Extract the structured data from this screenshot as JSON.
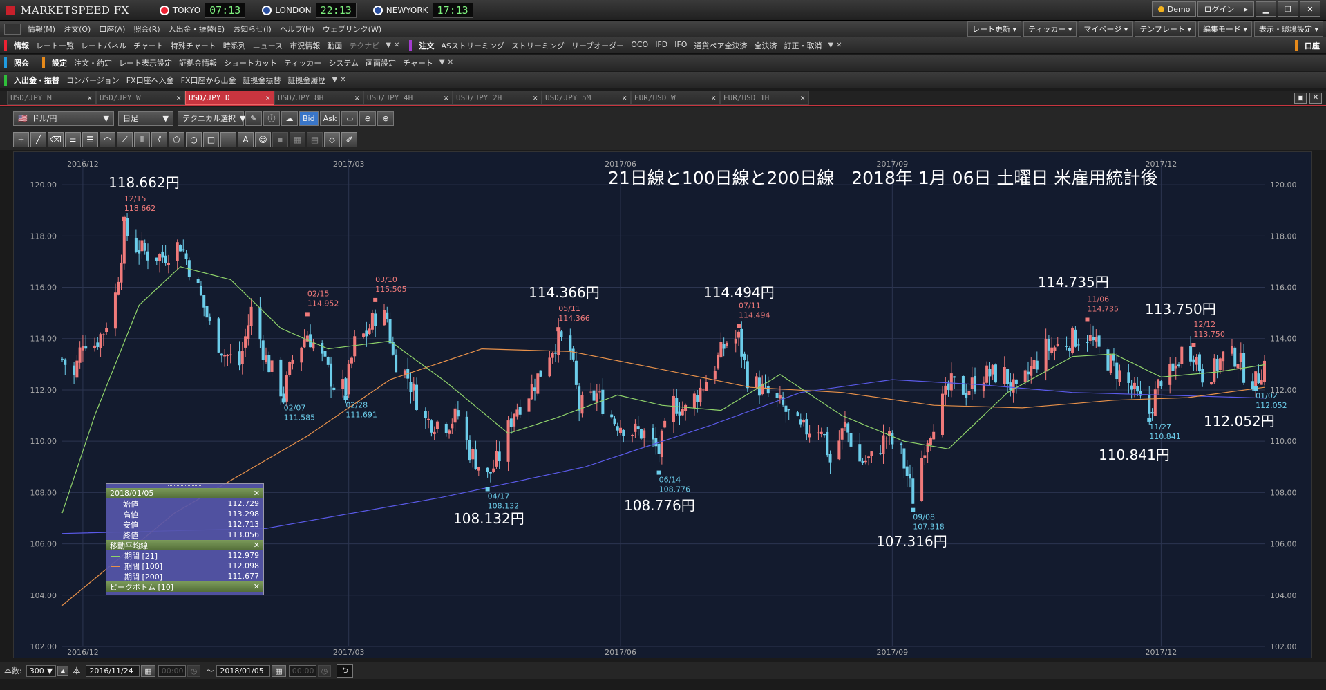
{
  "app": {
    "logo": "MARKETSPEED FX"
  },
  "clocks": [
    {
      "city": "TOKYO",
      "time": "07:13",
      "color": "#e23"
    },
    {
      "city": "LONDON",
      "time": "22:13",
      "color": "#2a4fa0"
    },
    {
      "city": "NEWYORK",
      "time": "17:13",
      "color": "#2a4fa0"
    }
  ],
  "window": {
    "demo": "Demo",
    "login": "ログイン"
  },
  "menu": [
    "情報(M)",
    "注文(O)",
    "口座(A)",
    "照会(R)",
    "入出金・振替(E)",
    "お知らせ(I)",
    "ヘルプ(H)",
    "ウェブリンク(W)"
  ],
  "menu_right": [
    "レート更新",
    "ティッカー",
    "マイページ",
    "テンプレート",
    "編集モード",
    "表示・環境設定"
  ],
  "toolbar1": {
    "info_head": "情報",
    "info_items": [
      "レート一覧",
      "レートパネル",
      "チャート",
      "特殊チャート",
      "時系列",
      "ニュース",
      "市況情報",
      "動画"
    ],
    "info_dim": "テクナビ",
    "order_head": "注文",
    "order_items": [
      "ASストリーミング",
      "ストリーミング",
      "リーブオーダー",
      "OCO",
      "IFD",
      "IFO",
      "通貨ペア全決済",
      "全決済",
      "訂正・取消"
    ],
    "right": "口座"
  },
  "toolbar2": {
    "inq_head": "照会",
    "set_head": "設定",
    "set_items": [
      "注文・約定",
      "レート表示設定",
      "証拠金情報",
      "ショートカット",
      "ティッカー",
      "システム",
      "画面設定",
      "チャート"
    ]
  },
  "toolbar3": {
    "head": "入出金・振替",
    "items": [
      "コンバージョン",
      "FX口座へ入金",
      "FX口座から出金",
      "証拠金振替",
      "証拠金履歴"
    ]
  },
  "tabs": [
    "USD/JPY M",
    "USD/JPY W",
    "USD/JPY D",
    "USD/JPY 8H",
    "USD/JPY 4H",
    "USD/JPY 2H",
    "USD/JPY 5M",
    "EUR/USD W",
    "EUR/USD 1H"
  ],
  "active_tab": 2,
  "chart_controls": {
    "pair": "ドル/円",
    "period": "日足",
    "tech": "テクニカル選択",
    "bid": "Bid",
    "ask": "Ask"
  },
  "overlay_title": "21日線と100日線と200日線　2018年 1月 06日 土曜日 米雇用統計後",
  "big_labels": [
    {
      "text": "118.662円"
    },
    {
      "text": "114.366円"
    },
    {
      "text": "114.494円"
    },
    {
      "text": "114.735円"
    },
    {
      "text": "113.750円"
    },
    {
      "text": "112.052円"
    },
    {
      "text": "110.841円"
    },
    {
      "text": "108.132円"
    },
    {
      "text": "108.776円"
    },
    {
      "text": "107.316円"
    }
  ],
  "info_box": {
    "date": "2018/01/05",
    "ohlc": [
      {
        "label": "始値",
        "value": "112.729"
      },
      {
        "label": "高値",
        "value": "113.298"
      },
      {
        "label": "安値",
        "value": "112.713"
      },
      {
        "label": "終値",
        "value": "113.056"
      }
    ],
    "ma_title": "移動平均線",
    "ma": [
      {
        "label": "期間 [21]",
        "value": "112.979",
        "color": "#8fd36a"
      },
      {
        "label": "期間 [100]",
        "value": "112.098",
        "color": "#e8914a"
      },
      {
        "label": "期間 [200]",
        "value": "111.677",
        "color": "#5a5ae8"
      }
    ],
    "peak_title": "ピークボトム [10]"
  },
  "status": {
    "count_label": "本数:",
    "count": "300",
    "unit": "本",
    "from_date": "2016/11/24",
    "from_time": "00:00",
    "tilde": "〜",
    "to_date": "2018/01/05",
    "to_time": "00:00"
  },
  "colors": {
    "up": "#f07a7a",
    "down": "#6ccdea",
    "ma21": "#8fd36a",
    "ma100": "#e8914a",
    "ma200": "#5a5ae8",
    "bg": "#131b2e",
    "accent": "#c8353f"
  },
  "chart_data": {
    "type": "candlestick",
    "title": "21日線と100日線と200日線　2018年 1月 06日 土曜日 米雇用統計後",
    "ylim": [
      102,
      121
    ],
    "y_ticks": [
      "102.00",
      "104.00",
      "106.00",
      "108.00",
      "110.00",
      "112.00",
      "114.00",
      "116.00",
      "118.00",
      "120.00"
    ],
    "x_ticks": [
      "2016/12",
      "2017/03",
      "2017/06",
      "2017/09",
      "2017/12"
    ],
    "x_tick_dates": [
      "2016-12-01",
      "2017-03-01",
      "2017-06-01",
      "2017-09-01",
      "2017-12-01"
    ],
    "start_date": "2016-11-24",
    "end_date": "2018-01-05",
    "close_path": [
      [
        "2016-11-24",
        113.2
      ],
      [
        "2016-11-28",
        112.5
      ],
      [
        "2016-12-01",
        114.0
      ],
      [
        "2016-12-05",
        113.8
      ],
      [
        "2016-12-08",
        114.3
      ],
      [
        "2016-12-12",
        115.7
      ],
      [
        "2016-12-15",
        118.2
      ],
      [
        "2016-12-19",
        117.6
      ],
      [
        "2016-12-23",
        117.3
      ],
      [
        "2016-12-28",
        117.2
      ],
      [
        "2017-01-03",
        117.7
      ],
      [
        "2017-01-06",
        116.8
      ],
      [
        "2017-01-10",
        115.6
      ],
      [
        "2017-01-13",
        114.5
      ],
      [
        "2017-01-18",
        113.4
      ],
      [
        "2017-01-23",
        113.0
      ],
      [
        "2017-01-27",
        115.1
      ],
      [
        "2017-02-01",
        113.2
      ],
      [
        "2017-02-07",
        111.8
      ],
      [
        "2017-02-10",
        113.2
      ],
      [
        "2017-02-15",
        114.2
      ],
      [
        "2017-02-20",
        113.2
      ],
      [
        "2017-02-24",
        112.2
      ],
      [
        "2017-02-28",
        112.0
      ],
      [
        "2017-03-03",
        113.8
      ],
      [
        "2017-03-07",
        114.2
      ],
      [
        "2017-03-10",
        114.9
      ],
      [
        "2017-03-14",
        114.8
      ],
      [
        "2017-03-16",
        113.3
      ],
      [
        "2017-03-21",
        112.5
      ],
      [
        "2017-03-27",
        110.8
      ],
      [
        "2017-04-03",
        110.7
      ],
      [
        "2017-04-07",
        111.0
      ],
      [
        "2017-04-11",
        109.6
      ],
      [
        "2017-04-17",
        108.6
      ],
      [
        "2017-04-21",
        109.4
      ],
      [
        "2017-04-26",
        111.2
      ],
      [
        "2017-05-01",
        111.9
      ],
      [
        "2017-05-05",
        112.7
      ],
      [
        "2017-05-08",
        113.5
      ],
      [
        "2017-05-11",
        114.0
      ],
      [
        "2017-05-15",
        113.5
      ],
      [
        "2017-05-18",
        111.3
      ],
      [
        "2017-05-24",
        111.8
      ],
      [
        "2017-05-30",
        110.8
      ],
      [
        "2017-06-05",
        110.4
      ],
      [
        "2017-06-09",
        110.3
      ],
      [
        "2017-06-14",
        109.6
      ],
      [
        "2017-06-19",
        111.5
      ],
      [
        "2017-06-23",
        111.2
      ],
      [
        "2017-06-29",
        112.2
      ],
      [
        "2017-07-03",
        113.0
      ],
      [
        "2017-07-07",
        113.9
      ],
      [
        "2017-07-11",
        114.0
      ],
      [
        "2017-07-14",
        112.5
      ],
      [
        "2017-07-20",
        111.9
      ],
      [
        "2017-07-26",
        111.3
      ],
      [
        "2017-08-01",
        110.4
      ],
      [
        "2017-08-08",
        110.6
      ],
      [
        "2017-08-11",
        109.2
      ],
      [
        "2017-08-16",
        110.6
      ],
      [
        "2017-08-21",
        109.2
      ],
      [
        "2017-08-25",
        109.3
      ],
      [
        "2017-08-30",
        110.2
      ],
      [
        "2017-09-04",
        109.5
      ],
      [
        "2017-09-08",
        107.8
      ],
      [
        "2017-09-12",
        109.9
      ],
      [
        "2017-09-15",
        110.8
      ],
      [
        "2017-09-21",
        112.2
      ],
      [
        "2017-09-26",
        112.0
      ],
      [
        "2017-10-02",
        112.6
      ],
      [
        "2017-10-09",
        112.6
      ],
      [
        "2017-10-13",
        111.8
      ],
      [
        "2017-10-18",
        112.8
      ],
      [
        "2017-10-23",
        113.6
      ],
      [
        "2017-10-27",
        113.7
      ],
      [
        "2017-11-01",
        114.0
      ],
      [
        "2017-11-06",
        114.1
      ],
      [
        "2017-11-10",
        113.5
      ],
      [
        "2017-11-15",
        112.9
      ],
      [
        "2017-11-20",
        112.2
      ],
      [
        "2017-11-24",
        111.5
      ],
      [
        "2017-11-27",
        111.1
      ],
      [
        "2017-12-01",
        112.5
      ],
      [
        "2017-12-05",
        112.6
      ],
      [
        "2017-12-08",
        113.5
      ],
      [
        "2017-12-12",
        113.5
      ],
      [
        "2017-12-15",
        112.6
      ],
      [
        "2017-12-19",
        112.8
      ],
      [
        "2017-12-22",
        113.3
      ],
      [
        "2017-12-27",
        113.3
      ],
      [
        "2017-12-29",
        112.7
      ],
      [
        "2018-01-02",
        112.3
      ],
      [
        "2018-01-05",
        113.06
      ]
    ],
    "ma21": [
      [
        "2016-11-24",
        107.2
      ],
      [
        "2016-12-05",
        111.0
      ],
      [
        "2016-12-20",
        115.3
      ],
      [
        "2017-01-03",
        116.8
      ],
      [
        "2017-01-20",
        116.3
      ],
      [
        "2017-02-06",
        114.4
      ],
      [
        "2017-02-22",
        113.6
      ],
      [
        "2017-03-15",
        113.9
      ],
      [
        "2017-04-03",
        112.3
      ],
      [
        "2017-04-24",
        110.3
      ],
      [
        "2017-05-10",
        110.9
      ],
      [
        "2017-05-31",
        111.8
      ],
      [
        "2017-06-15",
        111.4
      ],
      [
        "2017-07-05",
        111.2
      ],
      [
        "2017-07-25",
        112.6
      ],
      [
        "2017-08-15",
        111.0
      ],
      [
        "2017-09-05",
        110.0
      ],
      [
        "2017-09-20",
        109.7
      ],
      [
        "2017-10-10",
        111.9
      ],
      [
        "2017-11-01",
        113.3
      ],
      [
        "2017-11-15",
        113.4
      ],
      [
        "2017-12-01",
        112.5
      ],
      [
        "2017-12-20",
        112.7
      ],
      [
        "2018-01-05",
        112.98
      ]
    ],
    "ma100": [
      [
        "2016-11-24",
        103.6
      ],
      [
        "2017-01-01",
        107.2
      ],
      [
        "2017-02-15",
        110.2
      ],
      [
        "2017-03-15",
        112.4
      ],
      [
        "2017-04-15",
        113.6
      ],
      [
        "2017-05-15",
        113.5
      ],
      [
        "2017-06-15",
        112.8
      ],
      [
        "2017-07-15",
        112.1
      ],
      [
        "2017-08-15",
        111.9
      ],
      [
        "2017-09-15",
        111.4
      ],
      [
        "2017-10-15",
        111.3
      ],
      [
        "2017-11-15",
        111.6
      ],
      [
        "2017-12-10",
        111.7
      ],
      [
        "2018-01-05",
        112.1
      ]
    ],
    "ma200": [
      [
        "2016-11-24",
        106.4
      ],
      [
        "2017-02-01",
        106.6
      ],
      [
        "2017-04-01",
        107.8
      ],
      [
        "2017-05-20",
        109.0
      ],
      [
        "2017-07-01",
        110.6
      ],
      [
        "2017-08-01",
        111.9
      ],
      [
        "2017-09-01",
        112.4
      ],
      [
        "2017-10-01",
        112.2
      ],
      [
        "2017-11-01",
        111.9
      ],
      [
        "2017-12-01",
        111.8
      ],
      [
        "2018-01-05",
        111.68
      ]
    ],
    "peaks": [
      {
        "date": "12/15",
        "value": "118.662",
        "type": "high"
      },
      {
        "date": "02/15",
        "value": "114.952",
        "type": "high"
      },
      {
        "date": "03/10",
        "value": "115.505",
        "type": "high"
      },
      {
        "date": "05/11",
        "value": "114.366",
        "type": "high"
      },
      {
        "date": "07/11",
        "value": "114.494",
        "type": "high"
      },
      {
        "date": "11/06",
        "value": "114.735",
        "type": "high"
      },
      {
        "date": "12/12",
        "value": "113.750",
        "type": "high"
      },
      {
        "date": "02/07",
        "value": "111.585",
        "type": "low"
      },
      {
        "date": "02/28",
        "value": "111.691",
        "type": "low"
      },
      {
        "date": "04/17",
        "value": "108.132",
        "type": "low"
      },
      {
        "date": "06/14",
        "value": "108.776",
        "type": "low"
      },
      {
        "date": "09/08",
        "value": "107.318",
        "type": "low"
      },
      {
        "date": "11/27",
        "value": "110.841",
        "type": "low"
      },
      {
        "date": "01/02",
        "value": "112.052",
        "type": "low"
      }
    ]
  }
}
